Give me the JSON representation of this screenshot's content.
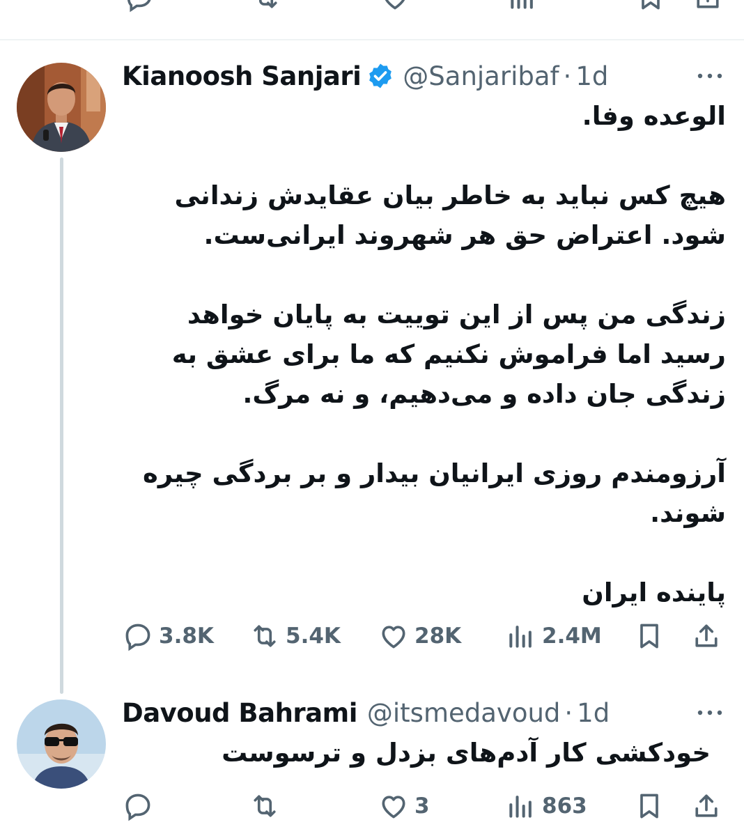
{
  "tweets": [
    {
      "name": "Kianoosh Sanjari",
      "verified": true,
      "handle": "@Sanjaribaf",
      "separator": "·",
      "time": "1d",
      "paragraphs": [
        "الوعده وفا.",
        "هیچ کس نباید به خاطر بیان عقایدش زندانی شود. اعتراض حق هر شهروند ایرانی‌ست.",
        "زندگی من پس از این توییت به پایان خواهد رسید اما فراموش نکنیم که ما برای عشق به زندگی جان داده و می‌دهیم، و نه مرگ.",
        "آرزومندم روزی ایرانیان بیدار و بر بردگی چیره شوند.",
        "پاینده ایران"
      ],
      "stats": {
        "replies": "3.8K",
        "retweets": "5.4K",
        "likes": "28K",
        "views": "2.4M"
      }
    },
    {
      "name": "Davoud Bahrami",
      "verified": false,
      "handle": "@itsmedavoud",
      "separator": "·",
      "time": "1d",
      "paragraphs": [
        "خودکشی کار آدم‌های بزدل و ترسوست"
      ],
      "stats": {
        "replies": "",
        "retweets": "",
        "likes": "3",
        "views": "863"
      }
    }
  ],
  "icons": {
    "reply": "reply-icon",
    "retweet": "retweet-icon",
    "like": "like-icon",
    "views": "views-icon",
    "bookmark": "bookmark-icon",
    "share": "share-icon",
    "verified": "verified-badge-icon",
    "more": "more-icon"
  },
  "colors": {
    "text": "#0f1419",
    "secondary": "#536471",
    "verified": "#1d9bf0",
    "thread_line": "#cfd9de"
  }
}
